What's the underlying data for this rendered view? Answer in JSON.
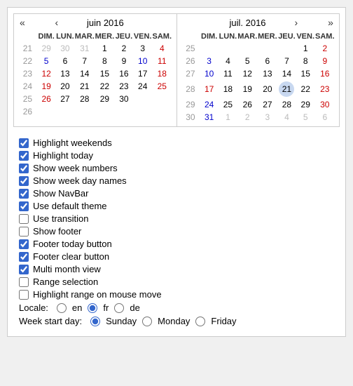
{
  "calendars": [
    {
      "title": "juin 2016",
      "nav_prev_double": "«",
      "nav_prev": "‹",
      "nav_next": "›",
      "nav_next_double": "»",
      "show_prev": true,
      "show_next": false,
      "day_headers": [
        "DIM.",
        "LUN.",
        "MAR.",
        "MER.",
        "JEU.",
        "VEN.",
        "SAM."
      ],
      "weeks": [
        {
          "week_num": "21",
          "days": [
            {
              "label": "29",
              "other": true,
              "weekend": true
            },
            {
              "label": "30",
              "other": true
            },
            {
              "label": "31",
              "other": true
            },
            {
              "label": "1",
              "weekend": false
            },
            {
              "label": "2",
              "weekend": false
            },
            {
              "label": "3",
              "weekend": false
            },
            {
              "label": "4",
              "weekend": true
            }
          ]
        },
        {
          "week_num": "22",
          "days": [
            {
              "label": "5",
              "weekend": true,
              "blue": true
            },
            {
              "label": "6"
            },
            {
              "label": "7"
            },
            {
              "label": "8"
            },
            {
              "label": "9"
            },
            {
              "label": "10",
              "blue": true
            },
            {
              "label": "11",
              "weekend": true
            }
          ]
        },
        {
          "week_num": "23",
          "days": [
            {
              "label": "12",
              "weekend": true
            },
            {
              "label": "13"
            },
            {
              "label": "14"
            },
            {
              "label": "15"
            },
            {
              "label": "16"
            },
            {
              "label": "17"
            },
            {
              "label": "18",
              "weekend": true
            }
          ]
        },
        {
          "week_num": "24",
          "days": [
            {
              "label": "19",
              "weekend": true
            },
            {
              "label": "20"
            },
            {
              "label": "21"
            },
            {
              "label": "22"
            },
            {
              "label": "23"
            },
            {
              "label": "24"
            },
            {
              "label": "25",
              "weekend": true
            }
          ]
        },
        {
          "week_num": "25",
          "days": [
            {
              "label": "26",
              "weekend": true
            },
            {
              "label": "27"
            },
            {
              "label": "28"
            },
            {
              "label": "29"
            },
            {
              "label": "30"
            },
            {
              "label": "",
              "empty": true
            },
            {
              "label": "",
              "empty": true
            }
          ]
        },
        {
          "week_num": "26",
          "days": [
            {
              "label": "",
              "empty": true
            },
            {
              "label": "",
              "empty": true
            },
            {
              "label": "",
              "empty": true
            },
            {
              "label": "",
              "empty": true
            },
            {
              "label": "",
              "empty": true
            },
            {
              "label": "",
              "empty": true
            },
            {
              "label": "",
              "empty": true
            }
          ]
        }
      ]
    },
    {
      "title": "juil. 2016",
      "show_prev": false,
      "show_next": true,
      "day_headers": [
        "DIM.",
        "LUN.",
        "MAR.",
        "MER.",
        "JEU.",
        "VEN.",
        "SAM."
      ],
      "weeks": [
        {
          "week_num": "25",
          "days": [
            {
              "label": "",
              "empty": true
            },
            {
              "label": "",
              "empty": true
            },
            {
              "label": "",
              "empty": true
            },
            {
              "label": "",
              "empty": true
            },
            {
              "label": "",
              "empty": true
            },
            {
              "label": "1"
            },
            {
              "label": "2",
              "weekend": true
            }
          ]
        },
        {
          "week_num": "26",
          "days": [
            {
              "label": "3",
              "weekend": true,
              "blue": true
            },
            {
              "label": "4"
            },
            {
              "label": "5"
            },
            {
              "label": "6"
            },
            {
              "label": "7"
            },
            {
              "label": "8"
            },
            {
              "label": "9",
              "weekend": true
            }
          ]
        },
        {
          "week_num": "27",
          "days": [
            {
              "label": "10",
              "weekend": true,
              "blue": true
            },
            {
              "label": "11"
            },
            {
              "label": "12"
            },
            {
              "label": "13"
            },
            {
              "label": "14"
            },
            {
              "label": "15"
            },
            {
              "label": "16",
              "weekend": true
            }
          ]
        },
        {
          "week_num": "28",
          "days": [
            {
              "label": "17",
              "weekend": true
            },
            {
              "label": "18"
            },
            {
              "label": "19"
            },
            {
              "label": "20"
            },
            {
              "label": "21",
              "today": true
            },
            {
              "label": "22"
            },
            {
              "label": "23",
              "weekend": true
            }
          ]
        },
        {
          "week_num": "29",
          "days": [
            {
              "label": "24",
              "weekend": true,
              "blue": true
            },
            {
              "label": "25"
            },
            {
              "label": "26"
            },
            {
              "label": "27"
            },
            {
              "label": "28"
            },
            {
              "label": "29"
            },
            {
              "label": "30",
              "weekend": true
            }
          ]
        },
        {
          "week_num": "30",
          "days": [
            {
              "label": "31",
              "weekend": true,
              "blue": true
            },
            {
              "label": "1",
              "other": true
            },
            {
              "label": "2",
              "other": true
            },
            {
              "label": "3",
              "other": true
            },
            {
              "label": "4",
              "other": true
            },
            {
              "label": "5",
              "other": true
            },
            {
              "label": "6",
              "other": true
            }
          ]
        }
      ]
    }
  ],
  "options": [
    {
      "id": "highlight_weekends",
      "label": "Highlight weekends",
      "checked": true
    },
    {
      "id": "highlight_today",
      "label": "Highlight today",
      "checked": true
    },
    {
      "id": "show_week_numbers",
      "label": "Show week numbers",
      "checked": true
    },
    {
      "id": "show_week_day_names",
      "label": "Show week day names",
      "checked": true
    },
    {
      "id": "show_navbar",
      "label": "Show NavBar",
      "checked": true
    },
    {
      "id": "use_default_theme",
      "label": "Use default theme",
      "checked": true
    },
    {
      "id": "use_transition",
      "label": "Use transition",
      "checked": false
    },
    {
      "id": "show_footer",
      "label": "Show footer",
      "checked": false
    },
    {
      "id": "footer_today_button",
      "label": "Footer today button",
      "checked": true
    },
    {
      "id": "footer_clear_button",
      "label": "Footer clear button",
      "checked": true
    },
    {
      "id": "multi_month_view",
      "label": "Multi month view",
      "checked": true
    },
    {
      "id": "range_selection",
      "label": "Range selection",
      "checked": false
    },
    {
      "id": "highlight_range",
      "label": "Highlight range on mouse move",
      "checked": false
    }
  ],
  "locale": {
    "label": "Locale:",
    "options": [
      {
        "value": "en",
        "label": "en"
      },
      {
        "value": "fr",
        "label": "fr"
      },
      {
        "value": "de",
        "label": "de"
      }
    ],
    "selected": "fr"
  },
  "week_start": {
    "label": "Week start day:",
    "options": [
      {
        "value": "sunday",
        "label": "Sunday"
      },
      {
        "value": "monday",
        "label": "Monday"
      },
      {
        "value": "friday",
        "label": "Friday"
      }
    ],
    "selected": "sunday"
  }
}
